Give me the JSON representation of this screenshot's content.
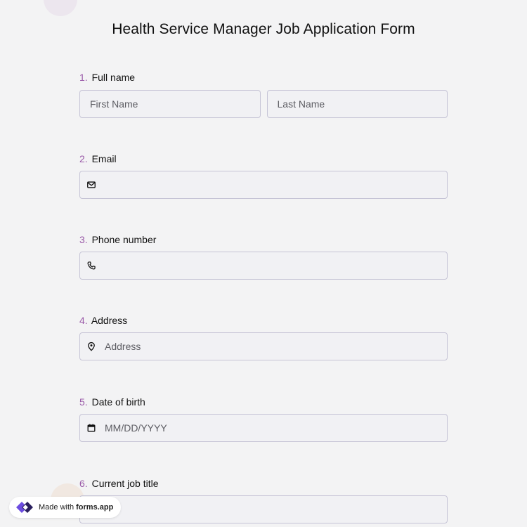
{
  "form": {
    "title": "Health Service Manager Job Application Form"
  },
  "questions": [
    {
      "number": "1.",
      "label": "Full name",
      "fields": [
        {
          "placeholder": "First Name"
        },
        {
          "placeholder": "Last Name"
        }
      ]
    },
    {
      "number": "2.",
      "label": "Email",
      "icon": "envelope-icon",
      "placeholder": ""
    },
    {
      "number": "3.",
      "label": "Phone number",
      "icon": "phone-icon",
      "placeholder": ""
    },
    {
      "number": "4.",
      "label": "Address",
      "icon": "map-pin-icon",
      "placeholder": "Address"
    },
    {
      "number": "5.",
      "label": "Date of birth",
      "icon": "calendar-icon",
      "placeholder": "MM/DD/YYYY"
    },
    {
      "number": "6.",
      "label": "Current job title",
      "placeholder": ""
    }
  ],
  "badge": {
    "prefix": "Made with",
    "brand": "forms.app",
    "icon": "forms-app-logo"
  },
  "colors": {
    "background": "#f3f3f4",
    "question_number": "#9a5aa8",
    "field_border": "#c6c4d6",
    "logo_primary": "#6c4ce0",
    "logo_dark": "#2a1f5e"
  }
}
